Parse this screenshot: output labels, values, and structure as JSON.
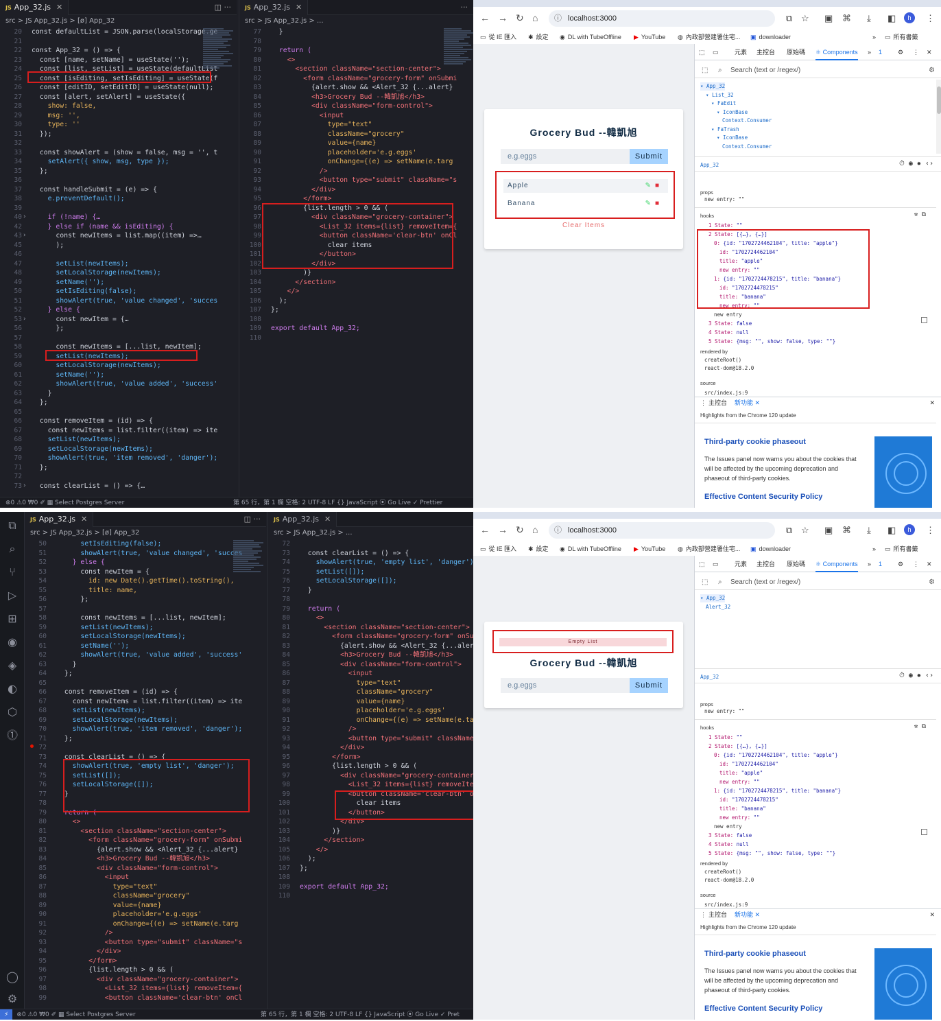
{
  "shared": {
    "file_name": "App_32.js",
    "js_badge": "JS",
    "url": "localhost:3000",
    "bookmarks": [
      "從 IE 匯入",
      "設定",
      "DL with TubeOffline",
      "YouTube",
      "內政部營建署住宅...",
      "downloader"
    ],
    "all_bookmarks": "所有書籤",
    "devtools_tabs": [
      "元素",
      "主控台",
      "原始碼",
      "Components"
    ],
    "devtools_badge": "1",
    "search_placeholder": "Search (text or /regex/)",
    "app_title": "Grocery Bud --韓凱旭",
    "input_placeholder": "e.g.eggs",
    "submit_label": "Submit",
    "component_name": "App_32",
    "props_label": "props",
    "props_line": "new entry: \"\"",
    "hooks_label": "hooks",
    "hooks": [
      "1 State: \"\"",
      "2 State: [{…}, {…}]",
      "0: {id: \"1702724462104\", title: \"apple\"}",
      "id: \"1702724462104\"",
      "title: \"apple\"",
      "new entry: \"\"",
      "1: {id: \"1702724478215\", title: \"banana\"}",
      "id: \"1702724478215\"",
      "title: \"banana\"",
      "new entry: \"\"",
      "new entry",
      "3 State: false",
      "4 State: null",
      "5 State: {msg: \"\", show: false, type: \"\"}"
    ],
    "rendered_by_label": "rendered by",
    "rendered_by": [
      "createRoot()",
      "react-dom@18.2.0"
    ],
    "source_label": "source",
    "source": "src/index.js:9",
    "drawer_tabs": [
      "主控台",
      "新功能"
    ],
    "whatsnew_header": "Highlights from the Chrome 120 update",
    "whatsnew_title1": "Third-party cookie phaseout",
    "whatsnew_body": "The Issues panel now warns you about the cookies that will be affected by the upcoming deprecation and phaseout of third-party cookies.",
    "whatsnew_title2": "Effective Content Security Policy"
  },
  "top": {
    "left_tab": "App_32.js",
    "left_crumb": "src > JS App_32.js > [ø] App_32",
    "right_tab": "App_32.js",
    "right_crumb": "src > JS App_32.js > ...",
    "left_code": [
      {
        "n": "20",
        "t": "const defaultList = JSON.parse(localStorage.ge",
        "c": "plain"
      },
      {
        "n": "21",
        "t": "",
        "c": "plain"
      },
      {
        "n": "22",
        "t": "const App_32 = () => {",
        "c": "plain"
      },
      {
        "n": "23",
        "t": "  const [name, setName] = useState('');",
        "c": "plain"
      },
      {
        "n": "24",
        "t": "  const [list, setList] = useState(defaultList",
        "c": "plain"
      },
      {
        "n": "25",
        "t": "  const [isEditing, setIsEditing] = useState(f",
        "c": "plain"
      },
      {
        "n": "26",
        "t": "  const [editID, setEditID] = useState(null);",
        "c": "plain"
      },
      {
        "n": "27",
        "t": "  const [alert, setAlert] = useState({",
        "c": "plain"
      },
      {
        "n": "28",
        "t": "    show: false,",
        "c": "attr"
      },
      {
        "n": "29",
        "t": "    msg: '',",
        "c": "attr"
      },
      {
        "n": "30",
        "t": "    type: ''",
        "c": "attr"
      },
      {
        "n": "31",
        "t": "  });",
        "c": "plain"
      },
      {
        "n": "32",
        "t": "",
        "c": "plain"
      },
      {
        "n": "33",
        "t": "  const showAlert = (show = false, msg = '', t",
        "c": "plain"
      },
      {
        "n": "34",
        "t": "    setAlert({ show, msg, type });",
        "c": "fn"
      },
      {
        "n": "35",
        "t": "  };",
        "c": "plain"
      },
      {
        "n": "36",
        "t": "",
        "c": "plain"
      },
      {
        "n": "37",
        "t": "  const handleSubmit = (e) => {",
        "c": "plain"
      },
      {
        "n": "38",
        "t": "    e.preventDefault();",
        "c": "fn"
      },
      {
        "n": "39",
        "t": "",
        "c": "plain"
      },
      {
        "n": "40",
        "t": "    if (!name) {…",
        "c": "kw"
      },
      {
        "n": "42",
        "t": "    } else if (name && isEditing) {",
        "c": "kw"
      },
      {
        "n": "43",
        "t": "      const newItems = list.map((item) =>…",
        "c": "plain"
      },
      {
        "n": "45",
        "t": "      );",
        "c": "plain"
      },
      {
        "n": "46",
        "t": "",
        "c": "plain"
      },
      {
        "n": "47",
        "t": "      setList(newItems);",
        "c": "fn"
      },
      {
        "n": "48",
        "t": "      setLocalStorage(newItems);",
        "c": "fn"
      },
      {
        "n": "49",
        "t": "      setName('');",
        "c": "fn"
      },
      {
        "n": "50",
        "t": "      setIsEditing(false);",
        "c": "fn"
      },
      {
        "n": "51",
        "t": "      showAlert(true, 'value changed', 'succes",
        "c": "fn"
      },
      {
        "n": "52",
        "t": "    } else {",
        "c": "kw"
      },
      {
        "n": "53",
        "t": "      const newItem = {…",
        "c": "plain"
      },
      {
        "n": "56",
        "t": "      };",
        "c": "plain"
      },
      {
        "n": "57",
        "t": "",
        "c": "plain"
      },
      {
        "n": "58",
        "t": "      const newItems = [...list, newItem];",
        "c": "plain"
      },
      {
        "n": "59",
        "t": "      setList(newItems);",
        "c": "fn"
      },
      {
        "n": "60",
        "t": "      setLocalStorage(newItems);",
        "c": "fn"
      },
      {
        "n": "61",
        "t": "      setName('');",
        "c": "fn"
      },
      {
        "n": "62",
        "t": "      showAlert(true, 'value added', 'success'",
        "c": "fn"
      },
      {
        "n": "63",
        "t": "    }",
        "c": "plain"
      },
      {
        "n": "64",
        "t": "  };",
        "c": "plain"
      },
      {
        "n": "65",
        "t": "",
        "c": "plain"
      },
      {
        "n": "66",
        "t": "  const removeItem = (id) => {",
        "c": "plain"
      },
      {
        "n": "67",
        "t": "    const newItems = list.filter((item) => ite",
        "c": "plain"
      },
      {
        "n": "68",
        "t": "    setList(newItems);",
        "c": "fn"
      },
      {
        "n": "69",
        "t": "    setLocalStorage(newItems);",
        "c": "fn"
      },
      {
        "n": "70",
        "t": "    showAlert(true, 'item removed', 'danger');",
        "c": "fn"
      },
      {
        "n": "71",
        "t": "  };",
        "c": "plain"
      },
      {
        "n": "72",
        "t": "",
        "c": "plain"
      },
      {
        "n": "73",
        "t": "  const clearList = () => {…",
        "c": "plain"
      }
    ],
    "right_code": [
      {
        "n": "77",
        "t": "  }",
        "c": "plain"
      },
      {
        "n": "78",
        "t": "",
        "c": "plain"
      },
      {
        "n": "79",
        "t": "  return (",
        "c": "kw"
      },
      {
        "n": "80",
        "t": "    <>",
        "c": "tag"
      },
      {
        "n": "81",
        "t": "      <section className=\"section-center\">",
        "c": "tag"
      },
      {
        "n": "82",
        "t": "        <form className=\"grocery-form\" onSubmi",
        "c": "tag"
      },
      {
        "n": "83",
        "t": "          {alert.show && <Alert_32 {...alert}",
        "c": "plain"
      },
      {
        "n": "84",
        "t": "          <h3>Grocery Bud --韓凱旭</h3>",
        "c": "tag"
      },
      {
        "n": "85",
        "t": "          <div className=\"form-control\">",
        "c": "tag"
      },
      {
        "n": "86",
        "t": "            <input",
        "c": "tag"
      },
      {
        "n": "87",
        "t": "              type=\"text\"",
        "c": "attr"
      },
      {
        "n": "88",
        "t": "              className=\"grocery\"",
        "c": "attr"
      },
      {
        "n": "89",
        "t": "              value={name}",
        "c": "attr"
      },
      {
        "n": "90",
        "t": "              placeholder='e.g.eggs'",
        "c": "attr"
      },
      {
        "n": "91",
        "t": "              onChange={(e) => setName(e.targ",
        "c": "attr"
      },
      {
        "n": "92",
        "t": "            />",
        "c": "tag"
      },
      {
        "n": "93",
        "t": "            <button type=\"submit\" className=\"s",
        "c": "tag"
      },
      {
        "n": "94",
        "t": "          </div>",
        "c": "tag"
      },
      {
        "n": "95",
        "t": "        </form>",
        "c": "tag"
      },
      {
        "n": "96",
        "t": "        {list.length > 0 && (",
        "c": "plain"
      },
      {
        "n": "97",
        "t": "          <div className=\"grocery-container\">",
        "c": "tag"
      },
      {
        "n": "98",
        "t": "            <List_32 items={list} removeItem={",
        "c": "tag"
      },
      {
        "n": "99",
        "t": "            <button className='clear-btn' onCl",
        "c": "tag"
      },
      {
        "n": "100",
        "t": "              clear items",
        "c": "plain"
      },
      {
        "n": "101",
        "t": "            </button>",
        "c": "tag"
      },
      {
        "n": "102",
        "t": "          </div>",
        "c": "tag"
      },
      {
        "n": "103",
        "t": "        )}",
        "c": "plain"
      },
      {
        "n": "104",
        "t": "      </section>",
        "c": "tag"
      },
      {
        "n": "105",
        "t": "    </>",
        "c": "tag"
      },
      {
        "n": "106",
        "t": "  );",
        "c": "plain"
      },
      {
        "n": "107",
        "t": "};",
        "c": "plain"
      },
      {
        "n": "108",
        "t": "",
        "c": "plain"
      },
      {
        "n": "109",
        "t": "export default App_32;",
        "c": "kw"
      },
      {
        "n": "110",
        "t": "",
        "c": "plain"
      }
    ],
    "status": "⊗0 ⚠0   ₩0   ✐   ▦ Select Postgres Server",
    "status_right": "第 65 行，第 1 欄   空格: 2   UTF-8   LF   {} JavaScript   ⦿ Go Live   ✓ Prettier",
    "tree": [
      "▾ App_32",
      "▾ List_32",
      "▾ FaEdit",
      "▾ IconBase",
      "Context.Consumer",
      "▾ FaTrash",
      "▾ IconBase",
      "Context.Consumer"
    ],
    "items": [
      "Apple",
      "Banana"
    ],
    "clear_label": "Clear Items"
  },
  "bottom": {
    "left_tab": "App_32.js",
    "left_crumb": "src > JS App_32.js > [ø] App_32",
    "right_tab": "App_32.js",
    "right_crumb": "src > JS App_32.js > ...",
    "left_code": [
      {
        "n": "50",
        "t": "      setIsEditing(false);",
        "c": "fn"
      },
      {
        "n": "51",
        "t": "      showAlert(true, 'value changed', 'succes",
        "c": "fn"
      },
      {
        "n": "52",
        "t": "    } else {",
        "c": "kw"
      },
      {
        "n": "53",
        "t": "      const newItem = {",
        "c": "plain"
      },
      {
        "n": "54",
        "t": "        id: new Date().getTime().toString(),",
        "c": "attr"
      },
      {
        "n": "55",
        "t": "        title: name,",
        "c": "attr"
      },
      {
        "n": "56",
        "t": "      };",
        "c": "plain"
      },
      {
        "n": "57",
        "t": "",
        "c": "plain"
      },
      {
        "n": "58",
        "t": "      const newItems = [...list, newItem];",
        "c": "plain"
      },
      {
        "n": "59",
        "t": "      setList(newItems);",
        "c": "fn"
      },
      {
        "n": "60",
        "t": "      setLocalStorage(newItems);",
        "c": "fn"
      },
      {
        "n": "61",
        "t": "      setName('');",
        "c": "fn"
      },
      {
        "n": "62",
        "t": "      showAlert(true, 'value added', 'success'",
        "c": "fn"
      },
      {
        "n": "63",
        "t": "    }",
        "c": "plain"
      },
      {
        "n": "64",
        "t": "  };",
        "c": "plain"
      },
      {
        "n": "65",
        "t": "",
        "c": "plain"
      },
      {
        "n": "66",
        "t": "  const removeItem = (id) => {",
        "c": "plain"
      },
      {
        "n": "67",
        "t": "    const newItems = list.filter((item) => ite",
        "c": "plain"
      },
      {
        "n": "68",
        "t": "    setList(newItems);",
        "c": "fn"
      },
      {
        "n": "69",
        "t": "    setLocalStorage(newItems);",
        "c": "fn"
      },
      {
        "n": "70",
        "t": "    showAlert(true, 'item removed', 'danger');",
        "c": "fn"
      },
      {
        "n": "71",
        "t": "  };",
        "c": "plain"
      },
      {
        "n": "72",
        "t": "",
        "c": "plain"
      },
      {
        "n": "73",
        "t": "  const clearList = () => {",
        "c": "plain"
      },
      {
        "n": "74",
        "t": "    showAlert(true, 'empty list', 'danger');",
        "c": "fn"
      },
      {
        "n": "75",
        "t": "    setList([]);",
        "c": "fn"
      },
      {
        "n": "76",
        "t": "    setLocalStorage([]);",
        "c": "fn"
      },
      {
        "n": "77",
        "t": "  }",
        "c": "plain"
      },
      {
        "n": "78",
        "t": "",
        "c": "plain"
      },
      {
        "n": "79",
        "t": "  return (",
        "c": "kw"
      },
      {
        "n": "80",
        "t": "    <>",
        "c": "tag"
      },
      {
        "n": "81",
        "t": "      <section className=\"section-center\">",
        "c": "tag"
      },
      {
        "n": "82",
        "t": "        <form className=\"grocery-form\" onSubmi",
        "c": "tag"
      },
      {
        "n": "83",
        "t": "          {alert.show && <Alert_32 {...alert}",
        "c": "plain"
      },
      {
        "n": "84",
        "t": "          <h3>Grocery Bud --韓凱旭</h3>",
        "c": "tag"
      },
      {
        "n": "85",
        "t": "          <div className=\"form-control\">",
        "c": "tag"
      },
      {
        "n": "86",
        "t": "            <input",
        "c": "tag"
      },
      {
        "n": "87",
        "t": "              type=\"text\"",
        "c": "attr"
      },
      {
        "n": "88",
        "t": "              className=\"grocery\"",
        "c": "attr"
      },
      {
        "n": "89",
        "t": "              value={name}",
        "c": "attr"
      },
      {
        "n": "90",
        "t": "              placeholder='e.g.eggs'",
        "c": "attr"
      },
      {
        "n": "91",
        "t": "              onChange={(e) => setName(e.targ",
        "c": "attr"
      },
      {
        "n": "92",
        "t": "            />",
        "c": "tag"
      },
      {
        "n": "93",
        "t": "            <button type=\"submit\" className=\"s",
        "c": "tag"
      },
      {
        "n": "94",
        "t": "          </div>",
        "c": "tag"
      },
      {
        "n": "95",
        "t": "        </form>",
        "c": "tag"
      },
      {
        "n": "96",
        "t": "        {list.length > 0 && (",
        "c": "plain"
      },
      {
        "n": "97",
        "t": "          <div className=\"grocery-container\">",
        "c": "tag"
      },
      {
        "n": "98",
        "t": "            <List_32 items={list} removeItem={",
        "c": "tag"
      },
      {
        "n": "99",
        "t": "            <button className='clear-btn' onCl",
        "c": "tag"
      }
    ],
    "right_code": [
      {
        "n": "72",
        "t": "",
        "c": "plain"
      },
      {
        "n": "73",
        "t": "  const clearList = () => {",
        "c": "plain"
      },
      {
        "n": "74",
        "t": "    showAlert(true, 'empty list', 'danger');",
        "c": "fn"
      },
      {
        "n": "75",
        "t": "    setList([]);",
        "c": "fn"
      },
      {
        "n": "76",
        "t": "    setLocalStorage([]);",
        "c": "fn"
      },
      {
        "n": "77",
        "t": "  }",
        "c": "plain"
      },
      {
        "n": "78",
        "t": "",
        "c": "plain"
      },
      {
        "n": "79",
        "t": "  return (",
        "c": "kw"
      },
      {
        "n": "80",
        "t": "    <>",
        "c": "tag"
      },
      {
        "n": "81",
        "t": "      <section className=\"section-center\">",
        "c": "tag"
      },
      {
        "n": "82",
        "t": "        <form className=\"grocery-form\" onSubmi",
        "c": "tag"
      },
      {
        "n": "83",
        "t": "          {alert.show && <Alert_32 {...alert}",
        "c": "plain"
      },
      {
        "n": "84",
        "t": "          <h3>Grocery Bud --韓凱旭</h3>",
        "c": "tag"
      },
      {
        "n": "85",
        "t": "          <div className=\"form-control\">",
        "c": "tag"
      },
      {
        "n": "86",
        "t": "            <input",
        "c": "tag"
      },
      {
        "n": "87",
        "t": "              type=\"text\"",
        "c": "attr"
      },
      {
        "n": "88",
        "t": "              className=\"grocery\"",
        "c": "attr"
      },
      {
        "n": "89",
        "t": "              value={name}",
        "c": "attr"
      },
      {
        "n": "90",
        "t": "              placeholder='e.g.eggs'",
        "c": "attr"
      },
      {
        "n": "91",
        "t": "              onChange={(e) => setName(e.targ",
        "c": "attr"
      },
      {
        "n": "92",
        "t": "            />",
        "c": "tag"
      },
      {
        "n": "93",
        "t": "            <button type=\"submit\" className=\"s",
        "c": "tag"
      },
      {
        "n": "94",
        "t": "          </div>",
        "c": "tag"
      },
      {
        "n": "95",
        "t": "        </form>",
        "c": "tag"
      },
      {
        "n": "96",
        "t": "        {list.length > 0 && (",
        "c": "plain"
      },
      {
        "n": "97",
        "t": "          <div className=\"grocery-container\">",
        "c": "tag"
      },
      {
        "n": "98",
        "t": "            <List_32 items={list} removeItem={",
        "c": "tag"
      },
      {
        "n": "99",
        "t": "            <button className='clear-btn' onCl",
        "c": "tag"
      },
      {
        "n": "100",
        "t": "              clear items",
        "c": "plain"
      },
      {
        "n": "101",
        "t": "            </button>",
        "c": "tag"
      },
      {
        "n": "102",
        "t": "          </div>",
        "c": "tag"
      },
      {
        "n": "103",
        "t": "        )}",
        "c": "plain"
      },
      {
        "n": "104",
        "t": "      </section>",
        "c": "tag"
      },
      {
        "n": "105",
        "t": "    </>",
        "c": "tag"
      },
      {
        "n": "106",
        "t": "  );",
        "c": "plain"
      },
      {
        "n": "107",
        "t": "};",
        "c": "plain"
      },
      {
        "n": "108",
        "t": "",
        "c": "plain"
      },
      {
        "n": "109",
        "t": "export default App_32;",
        "c": "kw"
      },
      {
        "n": "110",
        "t": "",
        "c": "plain"
      }
    ],
    "status": "⊗0 ⚠0   ₩0   ✐   ▦ Select Postgres Server",
    "status_right": "第 65 行，第 1 欄   空格: 2   UTF-8   LF   {} JavaScript   ⦿ Go Live   ✓ Pret",
    "tree": [
      "▾ App_32",
      "Alert_32"
    ],
    "alert_text": "Empty List"
  }
}
